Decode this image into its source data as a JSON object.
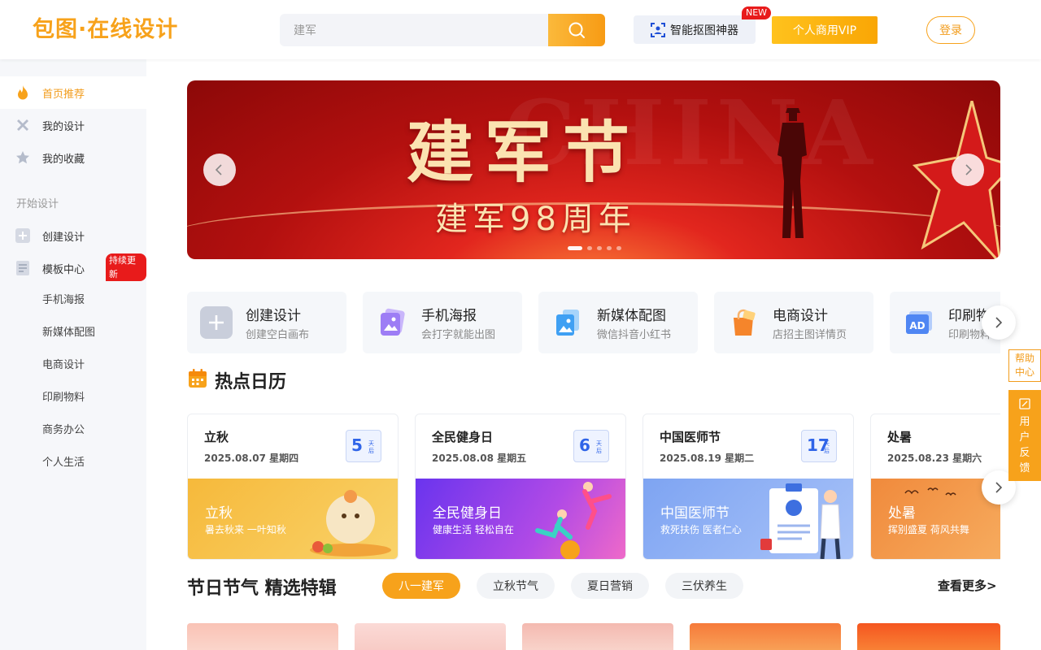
{
  "header": {
    "logo_text": "包图·在线设计",
    "search_value": "建军",
    "cutout_label": "智能抠图神器",
    "new_badge": "NEW",
    "vip_label": "个人商用VIP",
    "login_label": "登录"
  },
  "sidebar": {
    "items": [
      {
        "label": "首页推荐",
        "icon": "flame-icon"
      },
      {
        "label": "我的设计",
        "icon": "design-tools-icon"
      },
      {
        "label": "我的收藏",
        "icon": "star-icon"
      }
    ],
    "section_label": "开始设计",
    "create_label": "创建设计",
    "templates_label": "模板中心",
    "update_badge": "持续更新",
    "sub_items": [
      "手机海报",
      "新媒体配图",
      "电商设计",
      "印刷物料",
      "商务办公",
      "个人生活"
    ]
  },
  "banner": {
    "bg_text": "CHINA",
    "title": "建军节",
    "subtitle": "建军98周年"
  },
  "quick": [
    {
      "title": "创建设计",
      "sub": "创建空白画布",
      "icon": "plus-icon",
      "color": "#c9cedb"
    },
    {
      "title": "手机海报",
      "sub": "会打字就能出图",
      "icon": "image-card-icon",
      "color": "#a78bf6"
    },
    {
      "title": "新媒体配图",
      "sub": "微信抖音小红书",
      "icon": "media-image-icon",
      "color": "#4fa9f5"
    },
    {
      "title": "电商设计",
      "sub": "店招主图详情页",
      "icon": "shopping-bag-icon",
      "color": "#f5852b"
    },
    {
      "title": "印刷物料",
      "sub": "印刷物料",
      "icon": "ad-icon",
      "color": "#5b8ff5"
    }
  ],
  "calendar": {
    "title": "热点日历",
    "cards": [
      {
        "name": "立秋",
        "date": "2025.08.07 星期四",
        "days": "5",
        "days_unit": "天后",
        "img_title": "立秋",
        "img_sub": "暑去秋来 一叶知秋",
        "color_a": "#f6b93b",
        "color_b": "#f9d36a"
      },
      {
        "name": "全民健身日",
        "date": "2025.08.08 星期五",
        "days": "6",
        "days_unit": "天后",
        "img_title": "全民健身日",
        "img_sub": "健康生活 轻松自在",
        "color_a": "#7a3cf0",
        "color_b": "#e35ad9"
      },
      {
        "name": "中国医师节",
        "date": "2025.08.19 星期二",
        "days": "17",
        "days_unit": "天后",
        "img_title": "中国医师节",
        "img_sub": "救死扶伤 医者仁心",
        "color_a": "#7ea4f2",
        "color_b": "#a9c3f8"
      },
      {
        "name": "处暑",
        "date": "2025.08.23 星期六",
        "days": "",
        "days_unit": "",
        "img_title": "处暑",
        "img_sub": "挥别盛夏 荷风共舞",
        "color_a": "#f08a3c",
        "color_b": "#f9b86b"
      }
    ]
  },
  "festival": {
    "title": "节日节气 精选特辑",
    "tags": [
      "八一建军",
      "立秋节气",
      "夏日营销",
      "三伏养生"
    ],
    "more_label": "查看更多>"
  },
  "float": {
    "help_label": "帮助中心",
    "feedback_label": "用户反馈"
  }
}
